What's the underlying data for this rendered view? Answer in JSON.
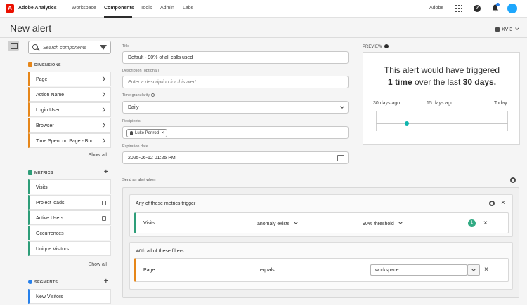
{
  "nav": {
    "app_name": "Adobe Analytics",
    "links": [
      "Workspace",
      "Components",
      "Tools",
      "Admin",
      "Labs"
    ],
    "active": "Components",
    "org": "Adobe"
  },
  "header": {
    "title": "New alert",
    "rsid": "XV 3"
  },
  "components": {
    "search_placeholder": "Search components",
    "dimensions_title": "DIMENSIONS",
    "dimensions": [
      "Page",
      "Action Name",
      "Login User",
      "Browser",
      "Time Spent on Page - Buc..."
    ],
    "metrics_title": "METRICS",
    "metrics": [
      "Visits",
      "Project loads",
      "Active Users",
      "Occurrences",
      "Unique Visitors"
    ],
    "segments_title": "SEGMENTS",
    "segments": [
      "New Visitors"
    ],
    "show_all": "Show all"
  },
  "form": {
    "title_label": "Title",
    "title_value": "Default - 90% of all calls used",
    "description_label": "Description (optional)",
    "description_placeholder": "Enter a description for this alert",
    "granularity_label": "Time granularity",
    "granularity_value": "Daily",
    "recipients_label": "Recipients",
    "recipient": "Luke Penrod",
    "expiration_label": "Expiration date",
    "expiration_value": "2025-06-12 01:25 PM"
  },
  "preview": {
    "label": "PREVIEW",
    "line1": "This alert would have triggered",
    "count": "1 time",
    "middle": "over the last",
    "period": "30 days.",
    "axis": [
      "30 days ago",
      "15 days ago",
      "Today"
    ]
  },
  "trigger": {
    "send_label": "Send an alert when",
    "metrics_title": "Any of these metrics trigger",
    "metric": "Visits",
    "condition": "anomaly exists",
    "threshold": "90% threshold",
    "badge": "1",
    "filters_title": "With all of these filters",
    "filter_dimension": "Page",
    "filter_operator": "equals",
    "filter_value": "workspace"
  },
  "colors": {
    "dimension": "#e68619",
    "metric": "#2d9d78",
    "segment": "#2680eb",
    "brand": "#eb1000",
    "timeline_dot": "#0fb5ae"
  }
}
